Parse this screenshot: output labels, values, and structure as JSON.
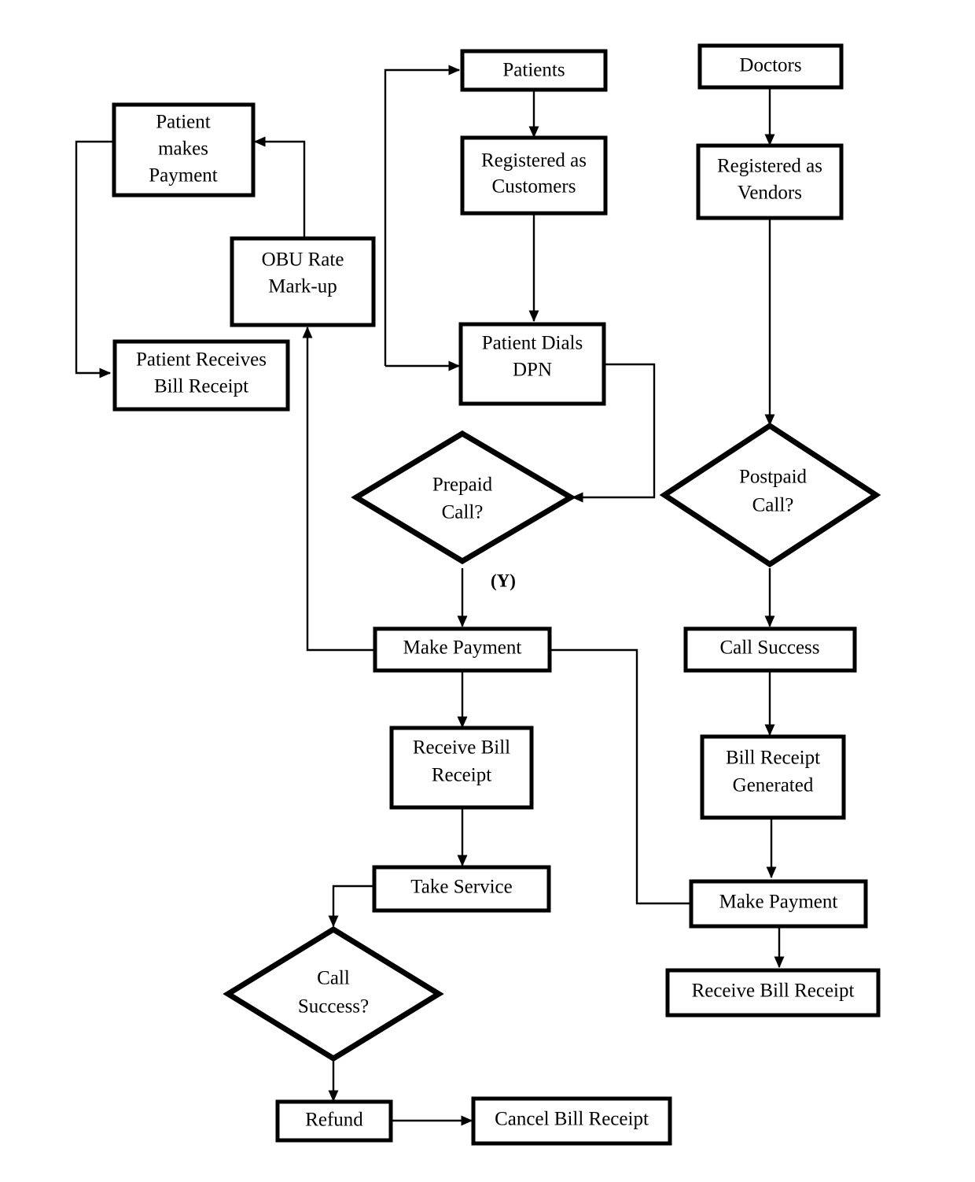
{
  "diagram": {
    "title": "Patient and Doctor Call Billing Flowchart",
    "background_color": "#ffffff",
    "stroke_color": "#000000",
    "nodes": [
      {
        "id": "patient_makes_payment",
        "label_lines": [
          "Patient",
          "makes",
          "Payment"
        ],
        "shape": "rectangle"
      },
      {
        "id": "patients",
        "label_lines": [
          "Patients"
        ],
        "shape": "rectangle"
      },
      {
        "id": "doctors",
        "label_lines": [
          "Doctors"
        ],
        "shape": "rectangle"
      },
      {
        "id": "registered_as_customers",
        "label_lines": [
          "Registered as",
          "Customers"
        ],
        "shape": "rectangle"
      },
      {
        "id": "registered_as_vendors",
        "label_lines": [
          "Registered as",
          "Vendors"
        ],
        "shape": "rectangle"
      },
      {
        "id": "obu_rate_markup",
        "label_lines": [
          "OBU Rate",
          "Mark-up"
        ],
        "shape": "rectangle"
      },
      {
        "id": "patient_receives_bill_receipt",
        "label_lines": [
          "Patient Receives",
          "Bill Receipt"
        ],
        "shape": "rectangle"
      },
      {
        "id": "patient_dials_dpn",
        "label_lines": [
          "Patient Dials",
          "DPN"
        ],
        "shape": "rectangle"
      },
      {
        "id": "prepaid_call",
        "label_lines": [
          "Prepaid",
          "Call?"
        ],
        "shape": "diamond"
      },
      {
        "id": "postpaid_call",
        "label_lines": [
          "Postpaid",
          "Call?"
        ],
        "shape": "diamond"
      },
      {
        "id": "make_payment_prepaid",
        "label_lines": [
          "Make Payment"
        ],
        "shape": "rectangle"
      },
      {
        "id": "call_success_box",
        "label_lines": [
          "Call Success"
        ],
        "shape": "rectangle"
      },
      {
        "id": "receive_bill_receipt_prepaid",
        "label_lines": [
          "Receive Bill",
          "Receipt"
        ],
        "shape": "rectangle"
      },
      {
        "id": "bill_receipt_generated",
        "label_lines": [
          "Bill Receipt",
          "Generated"
        ],
        "shape": "rectangle"
      },
      {
        "id": "take_service",
        "label_lines": [
          "Take Service"
        ],
        "shape": "rectangle"
      },
      {
        "id": "make_payment_postpaid",
        "label_lines": [
          "Make Payment"
        ],
        "shape": "rectangle"
      },
      {
        "id": "call_success_decision",
        "label_lines": [
          "Call",
          "Success?"
        ],
        "shape": "diamond"
      },
      {
        "id": "receive_bill_receipt_postpaid",
        "label_lines": [
          "Receive Bill Receipt"
        ],
        "shape": "rectangle"
      },
      {
        "id": "refund",
        "label_lines": [
          "Refund"
        ],
        "shape": "rectangle"
      },
      {
        "id": "cancel_bill_receipt",
        "label_lines": [
          "Cancel Bill Receipt"
        ],
        "shape": "rectangle"
      }
    ],
    "branch_labels": [
      {
        "id": "prepaid_yes",
        "text": "(Y)"
      }
    ],
    "text": {
      "patient_makes_payment_l1": "Patient",
      "patient_makes_payment_l2": "makes",
      "patient_makes_payment_l3": "Payment",
      "patients": "Patients",
      "doctors": "Doctors",
      "registered_as_customers_l1": "Registered as",
      "registered_as_customers_l2": "Customers",
      "registered_as_vendors_l1": "Registered as",
      "registered_as_vendors_l2": "Vendors",
      "obu_rate_markup_l1": "OBU Rate",
      "obu_rate_markup_l2": "Mark-up",
      "patient_receives_bill_receipt_l1": "Patient Receives",
      "patient_receives_bill_receipt_l2": "Bill Receipt",
      "patient_dials_dpn_l1": "Patient Dials",
      "patient_dials_dpn_l2": "DPN",
      "prepaid_call_l1": "Prepaid",
      "prepaid_call_l2": "Call?",
      "postpaid_call_l1": "Postpaid",
      "postpaid_call_l2": "Call?",
      "make_payment_prepaid": "Make Payment",
      "call_success_box": "Call Success",
      "receive_bill_receipt_prepaid_l1": "Receive Bill",
      "receive_bill_receipt_prepaid_l2": "Receipt",
      "bill_receipt_generated_l1": "Bill Receipt",
      "bill_receipt_generated_l2": "Generated",
      "take_service": "Take Service",
      "make_payment_postpaid": "Make Payment",
      "call_success_decision_l1": "Call",
      "call_success_decision_l2": "Success?",
      "receive_bill_receipt_postpaid": "Receive Bill Receipt",
      "refund": "Refund",
      "cancel_bill_receipt": "Cancel Bill Receipt",
      "prepaid_yes_label": "(Y)"
    }
  }
}
